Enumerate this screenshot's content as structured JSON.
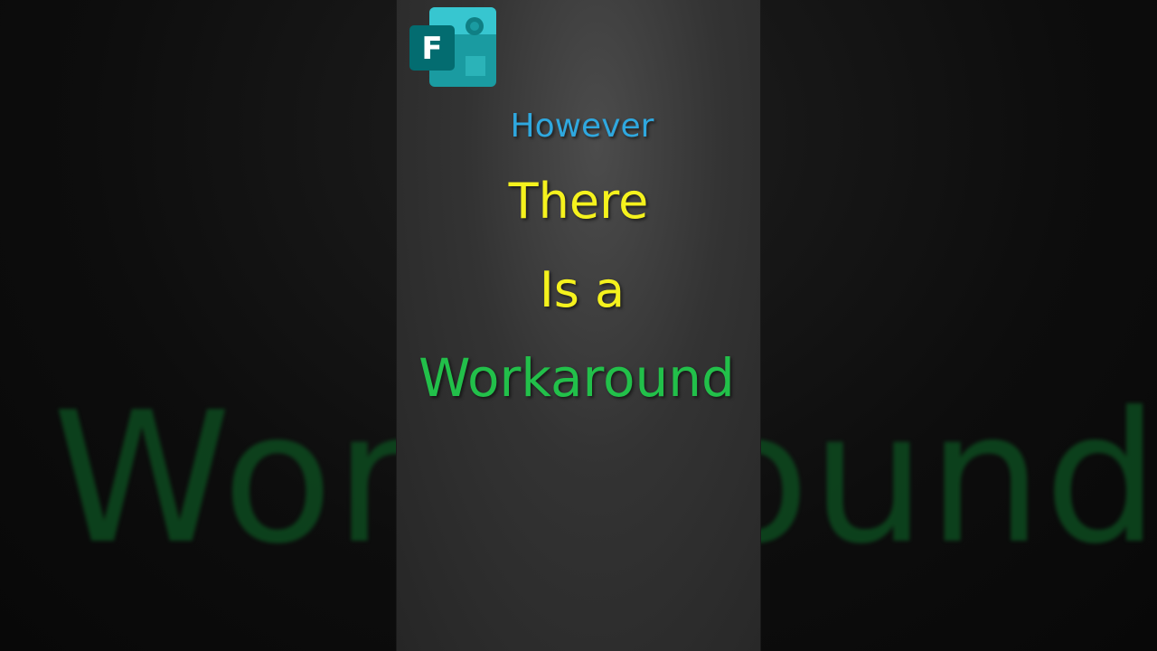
{
  "background": {
    "blurred_word": "Workaround"
  },
  "panel": {
    "logo": {
      "icon": "microsoft-forms-icon",
      "letter": "F"
    },
    "lines": {
      "however": "However",
      "there": "There",
      "is_a": "Is a",
      "workaround": "Workaround"
    }
  },
  "colors": {
    "however": "#2fa8df",
    "there": "#f5f21d",
    "workaround": "#22c04a",
    "forms_teal_dark": "#036c70",
    "forms_teal": "#1a9ba1",
    "forms_teal_light": "#37c6d0"
  }
}
